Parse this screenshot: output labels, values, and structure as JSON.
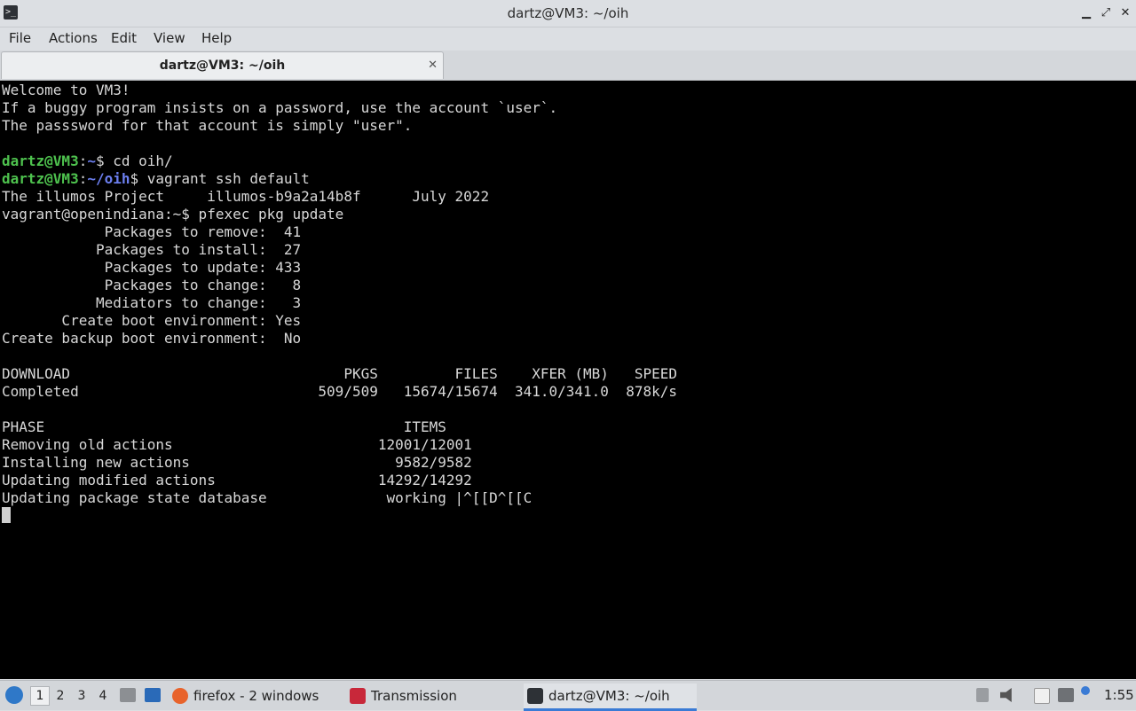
{
  "window": {
    "title": "dartz@VM3: ~/oih",
    "minimize_icon": "minimize-icon",
    "maximize_icon": "maximize-icon",
    "close_icon": "close-icon",
    "minimize_glyph": "▁",
    "maximize_glyph": "⤢",
    "close_glyph": "✕"
  },
  "menu": [
    "File",
    "Actions",
    "Edit",
    "View",
    "Help"
  ],
  "tab": {
    "label": "dartz@VM3: ~/oih",
    "close_glyph": "✕"
  },
  "terminal": {
    "colors": {
      "background": "#000000",
      "text": "#d8d8d8",
      "user_host": "#4ec24e",
      "path": "#6c7ff0"
    },
    "welcome": [
      "Welcome to VM3!",
      "If a buggy program insists on a password, use the account `user`.",
      "The passsword for that account is simply \"user\"."
    ],
    "prompt1": {
      "user": "dartz@VM3",
      "sep": ":",
      "path": "~",
      "cmd": "$ cd oih/"
    },
    "prompt2": {
      "user": "dartz@VM3",
      "sep": ":",
      "path": "~/oih",
      "cmd": "$ vagrant ssh default"
    },
    "banner": "The illumos Project     illumos-b9a2a14b8f      July 2022",
    "remote_cmd": "vagrant@openindiana:~$ pfexec pkg update",
    "plan": [
      "            Packages to remove:  41",
      "           Packages to install:  27",
      "            Packages to update: 433",
      "            Packages to change:   8",
      "           Mediators to change:   3",
      "       Create boot environment: Yes",
      "Create backup boot environment:  No"
    ],
    "download_header": "DOWNLOAD                                PKGS         FILES    XFER (MB)   SPEED",
    "download_row": "Completed                            509/509   15674/15674  341.0/341.0  878k/s",
    "phase_header": "PHASE                                          ITEMS",
    "phases": [
      "Removing old actions                        12001/12001",
      "Installing new actions                        9582/9582",
      "Updating modified actions                   14292/14292",
      "Updating package state database              working |^[[D^[[C"
    ]
  },
  "taskbar": {
    "menu_icon": "start-menu-icon",
    "workspaces": [
      "1",
      "2",
      "3",
      "4"
    ],
    "active_workspace": "1",
    "tasks": [
      {
        "label": "firefox - 2 windows",
        "icon": "firefox-icon"
      },
      {
        "label": "Transmission",
        "icon": "transmission-icon"
      },
      {
        "label": "dartz@VM3: ~/oih",
        "icon": "terminal-icon"
      }
    ],
    "clock": "1:55"
  }
}
